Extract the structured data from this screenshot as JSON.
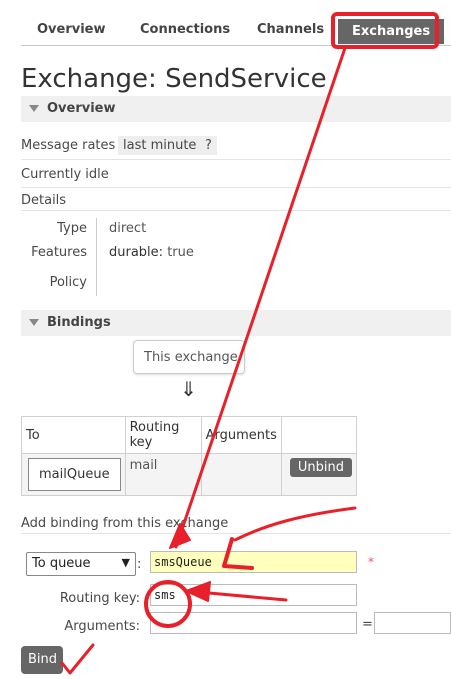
{
  "nav": {
    "items": [
      {
        "label": "Overview"
      },
      {
        "label": "Connections"
      },
      {
        "label": "Channels"
      },
      {
        "label": "Exchanges"
      }
    ]
  },
  "page": {
    "title": "Exchange: SendService"
  },
  "overview": {
    "header": "Overview",
    "message_rates_label": "Message rates",
    "message_rates_value": "last minute",
    "help": "?",
    "status": "Currently idle",
    "details_label": "Details",
    "details": {
      "type_label": "Type",
      "type_value": "direct",
      "features_label": "Features",
      "features_key": "durable:",
      "features_value": "true",
      "policy_label": "Policy"
    }
  },
  "bindings": {
    "header": "Bindings",
    "this_exchange": "This exchange",
    "arrow": "⇓",
    "columns": [
      "To",
      "Routing key",
      "Arguments"
    ],
    "rows": [
      {
        "to": "mailQueue",
        "routing_key": "mail",
        "arguments": "",
        "action": "Unbind"
      }
    ]
  },
  "add_binding": {
    "title": "Add binding from this exchange",
    "destination_type": "To queue",
    "destination_value": "smsQueue",
    "required_mark": "*",
    "routing_key_label": "Routing key:",
    "routing_key_value": "sms",
    "arguments_label": "Arguments:",
    "equals": "=",
    "bind_button": "Bind"
  },
  "colors": {
    "annotation": "#e8202a",
    "nav_active": "#666666",
    "highlight_input": "#ffffbe"
  }
}
